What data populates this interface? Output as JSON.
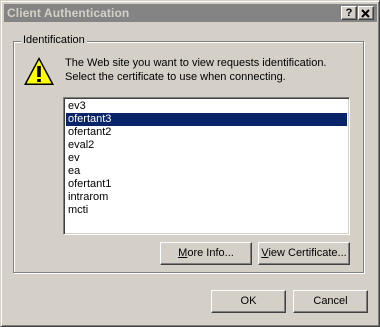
{
  "window": {
    "title": "Client Authentication",
    "help_label": "?",
    "close_label": "X"
  },
  "group": {
    "label": "Identification"
  },
  "message": {
    "line1": "The Web site you want to view requests identification.",
    "line2": "Select the certificate to use when connecting."
  },
  "certificates": {
    "items": [
      "ev3",
      "ofertant3",
      "ofertant2",
      "eval2",
      "ev",
      "ea",
      "ofertant1",
      "intrarom",
      "mcti"
    ],
    "selected": "ofertant3"
  },
  "buttons": {
    "more_info_accel": "M",
    "more_info_rest": "ore Info...",
    "view_cert_accel": "V",
    "view_cert_rest": "iew Certificate...",
    "ok": "OK",
    "cancel": "Cancel"
  },
  "colors": {
    "face": "#d4d0c8",
    "selection": "#0a246a",
    "titlebar_inactive": "#848484"
  },
  "icons": {
    "warning": "warning-icon"
  }
}
